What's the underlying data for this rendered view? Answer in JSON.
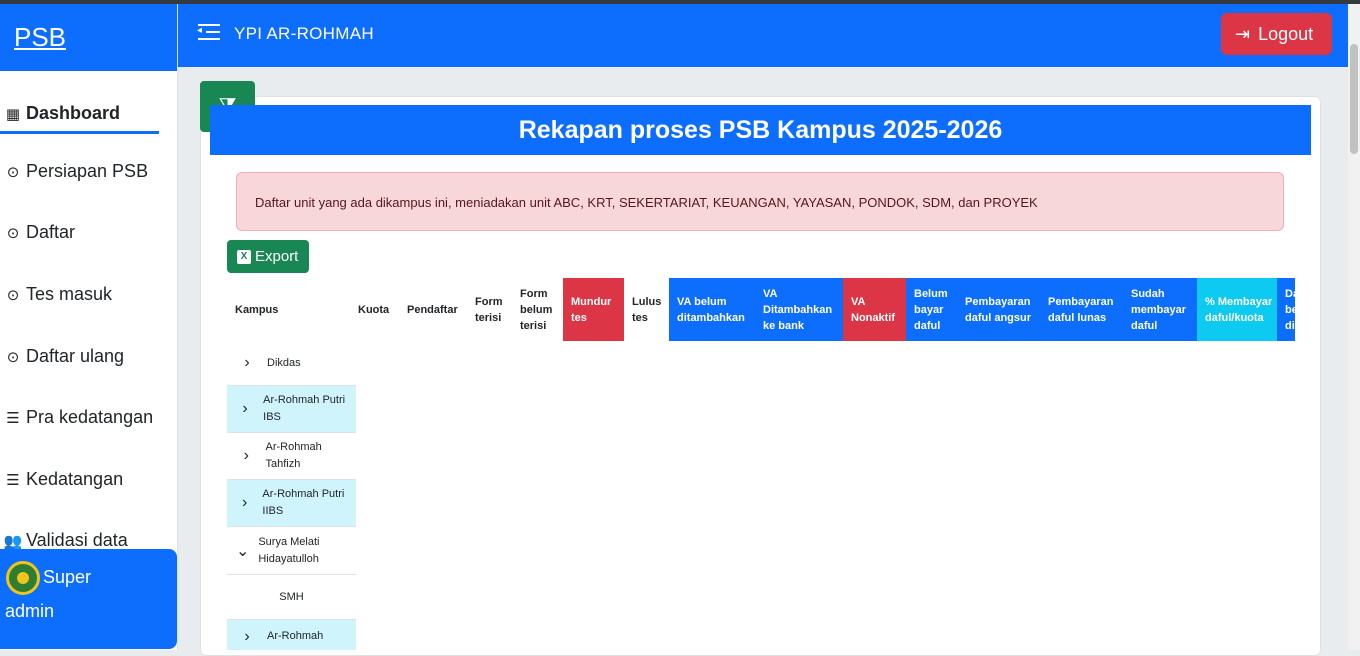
{
  "brand": "PSB",
  "header": {
    "title": "YPI AR-ROHMAH",
    "logout_label": "Logout"
  },
  "sidebar": {
    "items": [
      {
        "label": "Dashboard",
        "icon": "grid-icon"
      },
      {
        "label": "Persiapan PSB",
        "icon": "check-circle-icon"
      },
      {
        "label": "Daftar",
        "icon": "check-circle-icon"
      },
      {
        "label": "Tes masuk",
        "icon": "check-circle-icon"
      },
      {
        "label": "Daftar ulang",
        "icon": "check-circle-icon"
      },
      {
        "label": "Pra kedatangan",
        "icon": "list-check-icon"
      },
      {
        "label": "Kedatangan",
        "icon": "list-check-icon"
      },
      {
        "label": "Validasi data",
        "icon": "users-icon"
      }
    ],
    "user": {
      "line1": "Super",
      "line2": "admin"
    }
  },
  "main": {
    "title": "Rekapan proses PSB Kampus 2025-2026",
    "alert": "Daftar unit yang ada dikampus ini, meniadakan unit ABC, KRT, SEKERTARIAT, KEUANGAN, YAYASAN, PONDOK, SDM, dan PROYEK",
    "export_label": "Export",
    "table": {
      "headers": [
        "Kampus",
        "Kuota",
        "Pendaftar",
        "Form terisi",
        "Form belum terisi",
        "Mundur tes",
        "Lulus tes",
        "VA belum ditambahkan",
        "VA Ditambahkan ke bank",
        "VA Nonaktif",
        "Belum bayar daful",
        "Pembayaran daful angsur",
        "Pembayaran daful lunas",
        "Sudah membayar daful",
        "% Membayar daful/kuota",
        "Da be di"
      ],
      "rows": [
        {
          "label": "Dikdas",
          "chevron": "›"
        },
        {
          "label": "Ar-Rohmah Putri IBS",
          "chevron": "›"
        },
        {
          "label": "Ar-Rohmah Tahfizh",
          "chevron": "›"
        },
        {
          "label": "Ar-Rohmah Putri IIBS",
          "chevron": "›"
        },
        {
          "label": "Surya Melati Hidayatulloh",
          "chevron": "⌄"
        },
        {
          "label": "SMH",
          "chevron": ""
        },
        {
          "label": "Ar-Rohmah",
          "chevron": "›"
        }
      ]
    }
  },
  "colors": {
    "primary": "#0d6efd",
    "danger": "#dc3545",
    "success": "#198754",
    "info": "#0dcaf0"
  }
}
